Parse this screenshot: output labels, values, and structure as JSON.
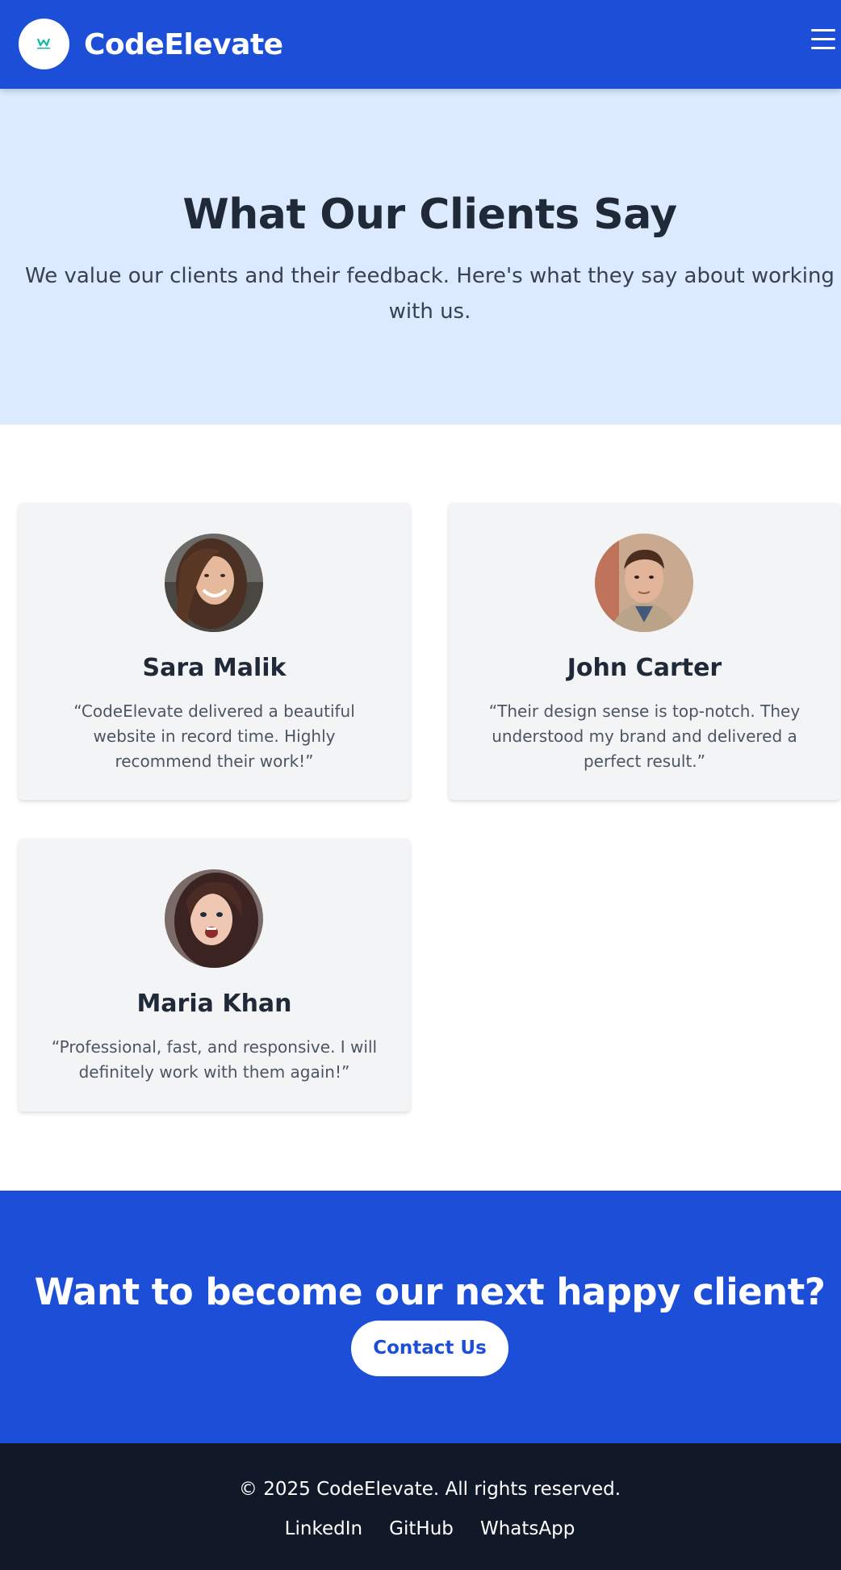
{
  "header": {
    "brand": "CodeElevate",
    "logo_icon": "codeelevate-logo",
    "menu_icon": "hamburger-menu-icon"
  },
  "hero": {
    "title": "What Our Clients Say",
    "subtitle": "We value our clients and their feedback. Here's what they say about working with us."
  },
  "testimonials": [
    {
      "name": "Sara Malik",
      "quote": "“CodeElevate delivered a beautiful website in record time. Highly recommend their work!”",
      "avatar": "sara-malik-photo"
    },
    {
      "name": "John Carter",
      "quote": "“Their design sense is top-notch. They understood my brand and delivered a perfect result.”",
      "avatar": "john-carter-photo"
    },
    {
      "name": "Maria Khan",
      "quote": "“Professional, fast, and responsive. I will definitely work with them again!”",
      "avatar": "maria-khan-photo"
    }
  ],
  "cta": {
    "heading": "Want to become our next happy client?",
    "button": "Contact Us"
  },
  "footer": {
    "copyright": "© 2025 CodeElevate. All rights reserved.",
    "links": [
      "LinkedIn",
      "GitHub",
      "WhatsApp"
    ]
  },
  "colors": {
    "primary": "#1d4ed8",
    "hero_bg": "#dbeafe",
    "card_bg": "#f3f4f6",
    "footer_bg": "#111827",
    "text_dark": "#1f2937"
  }
}
